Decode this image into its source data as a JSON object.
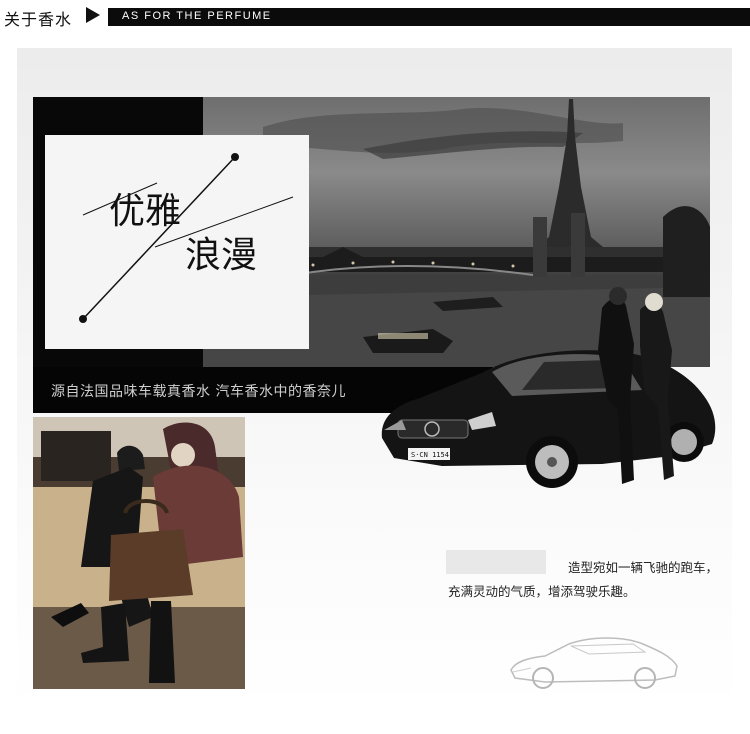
{
  "header": {
    "title_cn": "关于香水",
    "banner_en": "AS FOR THE PERFUME"
  },
  "hero": {
    "title_line1": "优雅",
    "title_line2": "浪漫",
    "plate": "S·CN 1154"
  },
  "tagline": "源自法国品味车载真香水  汽车香水中的香奈儿",
  "description": {
    "line1": "造型宛如一辆飞驰的跑车，",
    "line2": "充满灵动的气质，增添驾驶乐趣。"
  },
  "icons": {
    "header_arrow": "arrow-right-icon",
    "car": "car-illustration",
    "sketch": "sportscar-sketch-icon"
  },
  "colors": {
    "banner_bg": "#0b0b0b",
    "panel_bg": "#080808",
    "tagline_text": "#cfcfcf"
  }
}
